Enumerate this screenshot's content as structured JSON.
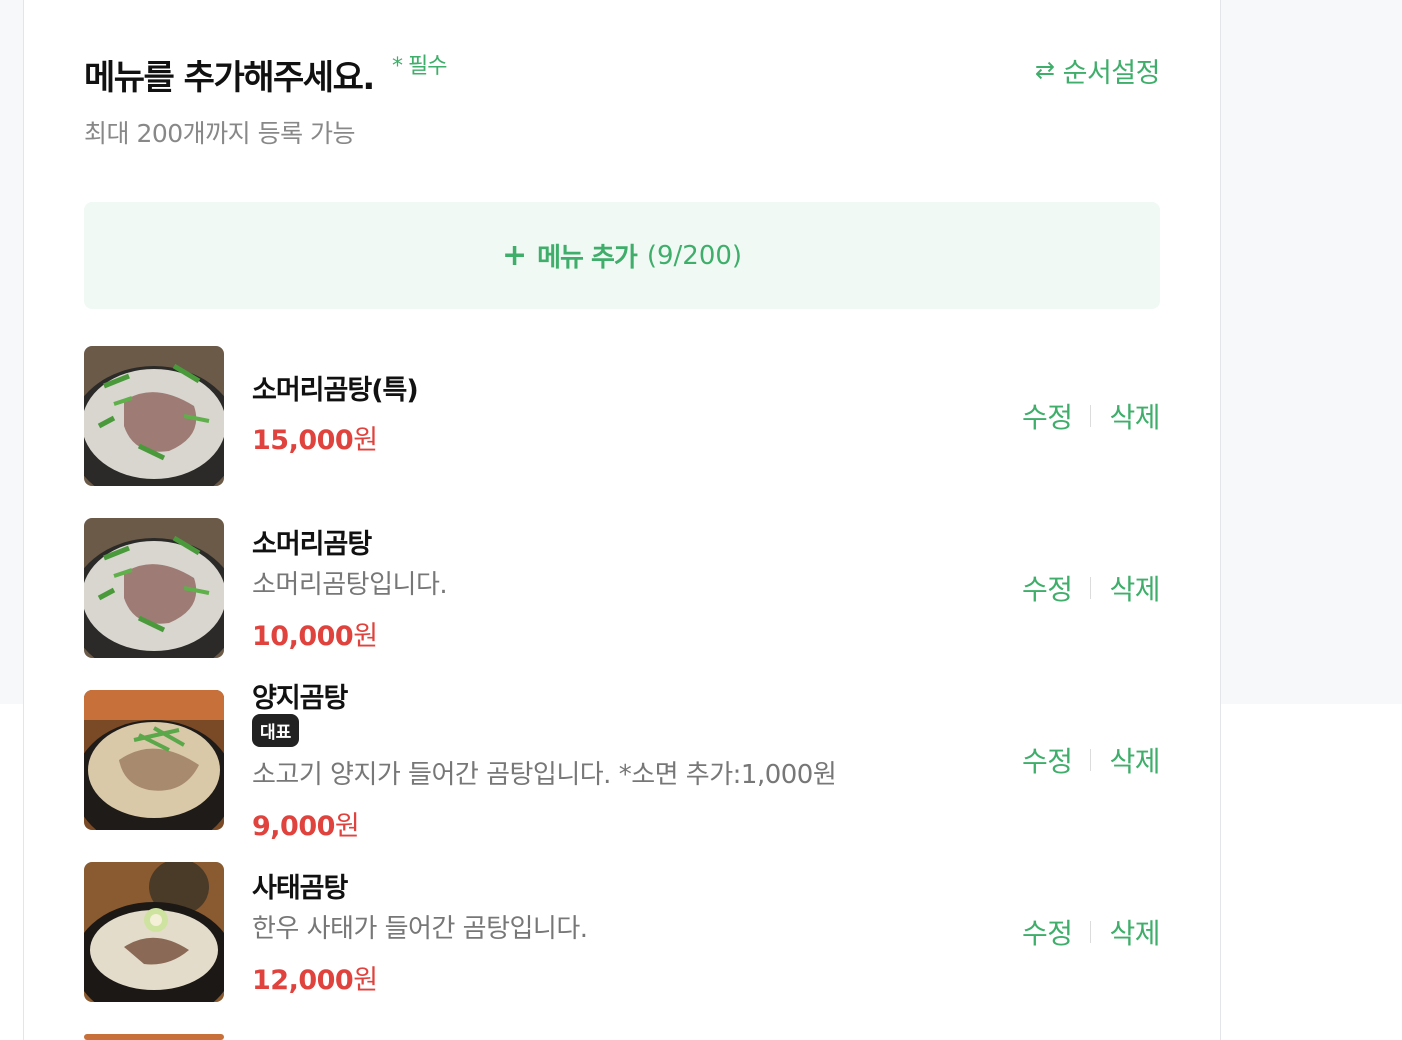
{
  "header": {
    "title": "메뉴를 추가해주세요.",
    "required_label": "* 필수",
    "subtitle": "최대 200개까지 등록 가능",
    "order_button": "순서설정",
    "order_icon": "swap-icon"
  },
  "add_button": {
    "plus": "+",
    "label": "메뉴 추가",
    "count": "(9/200)"
  },
  "actions": {
    "edit_label": "수정",
    "delete_label": "삭제"
  },
  "menu_items": [
    {
      "name": "소머리곰탕(특)",
      "description": "",
      "price_number": "15,000",
      "price_unit": "원",
      "badge": ""
    },
    {
      "name": "소머리곰탕",
      "description": "소머리곰탕입니다.",
      "price_number": "10,000",
      "price_unit": "원",
      "badge": ""
    },
    {
      "name": "양지곰탕",
      "description": "소고기 양지가 들어간 곰탕입니다. *소면 추가:1,000원",
      "price_number": "9,000",
      "price_unit": "원",
      "badge": "대표"
    },
    {
      "name": "사태곰탕",
      "description": "한우 사태가 들어간 곰탕입니다.",
      "price_number": "12,000",
      "price_unit": "원",
      "badge": ""
    }
  ],
  "colors": {
    "accent_green": "#3fae6a",
    "price_red": "#e0433d",
    "add_button_bg": "#f1f9f5"
  }
}
